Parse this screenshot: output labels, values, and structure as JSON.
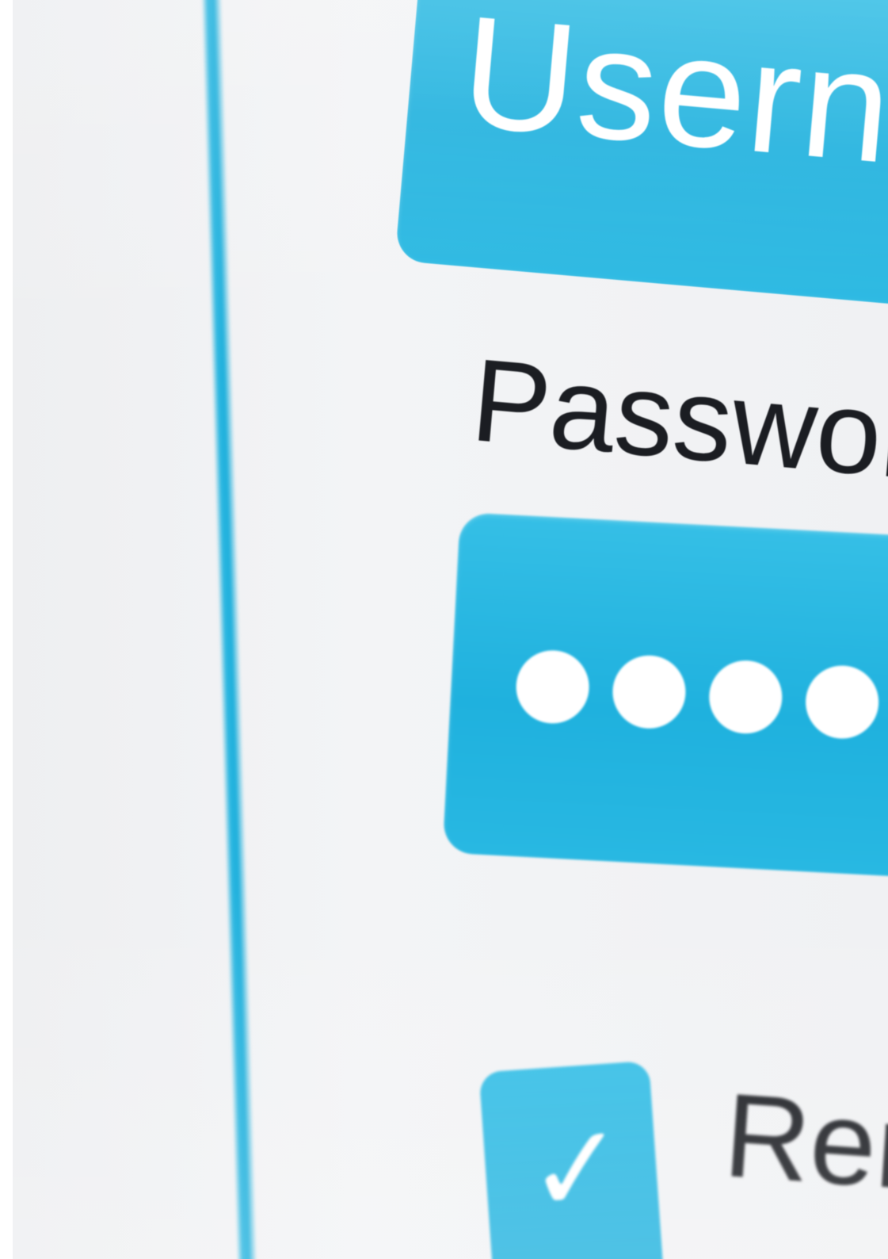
{
  "login_form": {
    "username_field": {
      "value": "Userna"
    },
    "password_label": "Password",
    "password_field": {
      "masked_value": "●●●●●"
    },
    "remember_checkbox": {
      "checked": true,
      "check_glyph": "✓",
      "label": "Rem"
    }
  },
  "colors": {
    "accent": "#1fb1de",
    "background": "#f1f2f4",
    "text": "#1b1d22"
  },
  "icons": {
    "checkmark": "checkmark-icon"
  }
}
